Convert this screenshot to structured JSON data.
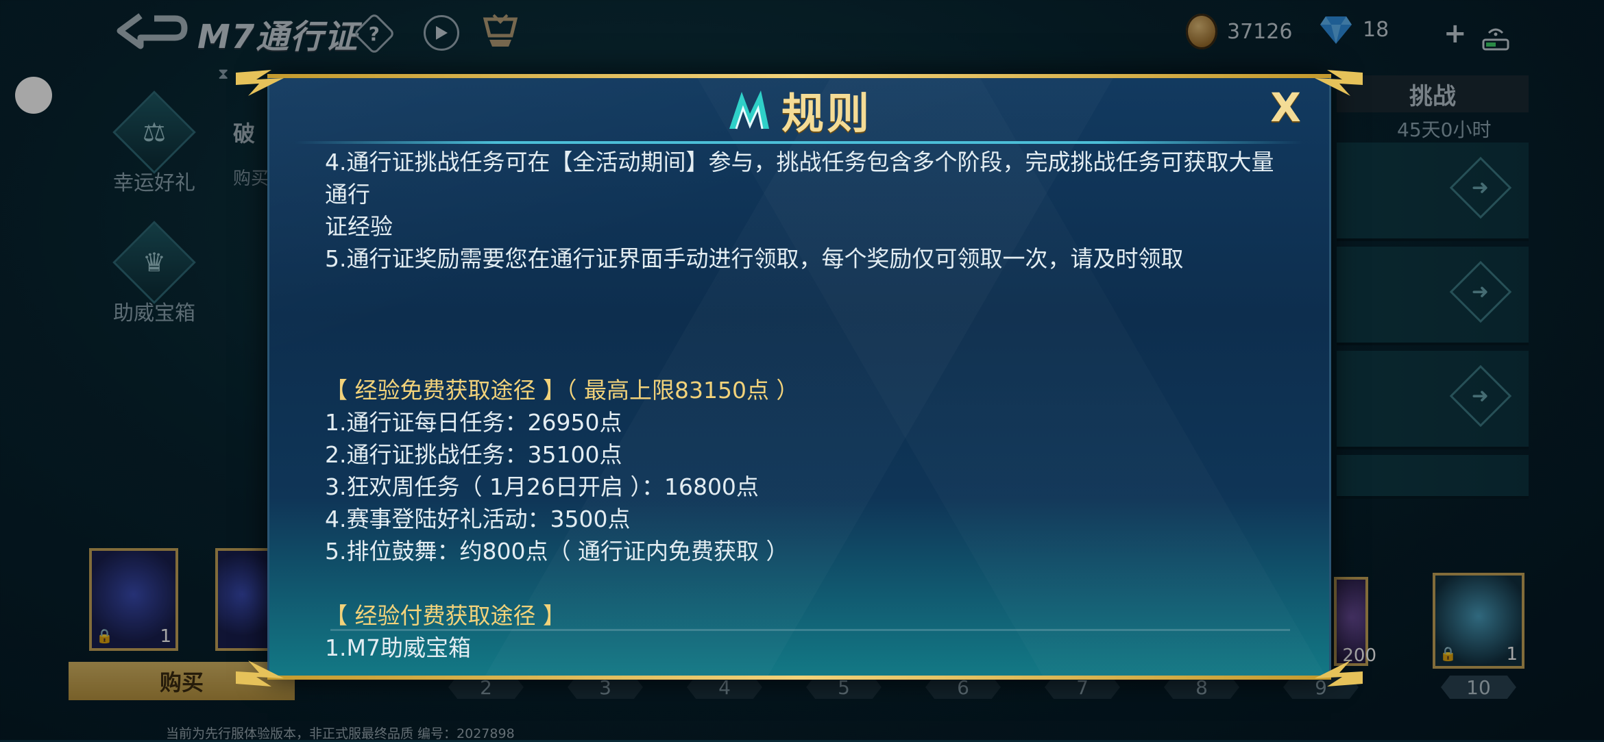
{
  "topbar": {
    "pass_title": "M7通行证",
    "help_label": "?",
    "coins": "37126",
    "gems": "18",
    "plus_label": "+"
  },
  "side_menu": [
    {
      "label": "幸运好礼",
      "icon": "scales-icon"
    },
    {
      "label": "助威宝箱",
      "icon": "chest-icon"
    }
  ],
  "background_left": {
    "heading": "破",
    "sub": "购买"
  },
  "right_panel": {
    "tab": "挑战",
    "timer": "45天0小时"
  },
  "modal": {
    "title": "规则",
    "close_label": "X",
    "lines": {
      "l1a": "4.通行证挑战任务可在【全活动期间】参与，挑战任务包含多个阶段，完成挑战任务可获取大量通行",
      "l1b": "证经验",
      "l2": "5.通行证奖励需要您在通行证界面手动进行领取，每个奖励仅可领取一次，请及时领取",
      "free_title": "【 经验免费获取途径 】（ 最高上限83150点 ）",
      "f1": "1.通行证每日任务：26950点",
      "f2": "2.通行证挑战任务：35100点",
      "f3": "3.狂欢周任务（ 1月26日开启 ）：16800点",
      "f4": "4.赛事登陆好礼活动：3500点",
      "f5": "5.排位鼓舞：约800点（ 通行证内免费获取 ）",
      "paid_title": "【 经验付费获取途径 】",
      "p1": "1.M7助威宝箱"
    }
  },
  "rewards": {
    "left_count": "1",
    "right_count": "1",
    "partial_count": "200",
    "buy_label": "购买",
    "levels": [
      "2",
      "3",
      "4",
      "5",
      "6",
      "7",
      "8",
      "9",
      "10"
    ]
  },
  "footer": "当前为先行服体验版本，非正式服最终品质  编号：2027898",
  "colors": {
    "gold": "#f4dc96",
    "accent_line": "#4cbed7",
    "modal_bg": "#0d2e4e"
  }
}
